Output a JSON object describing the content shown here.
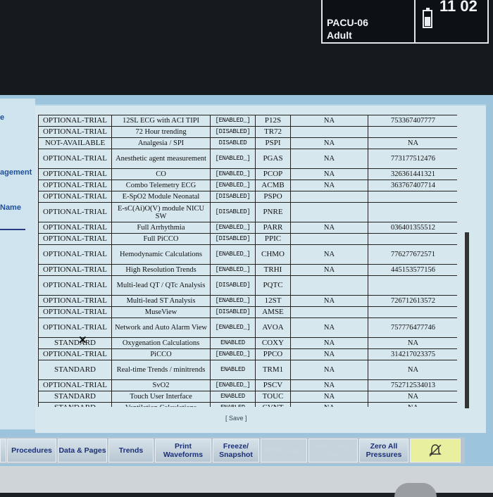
{
  "status": {
    "patient_id": "PACU-06",
    "patient_type": "Adult",
    "clock": "11 02"
  },
  "left_labels": {
    "item1": "e",
    "item2": "agement",
    "item3": "Name"
  },
  "rows": [
    {
      "status": "OPTIONAL-TRIAL",
      "name": "12SL ECG with ACI TIPI",
      "state": "[ENABLED_]",
      "code": "P12S",
      "na": "NA",
      "serial": "753367407777"
    },
    {
      "status": "OPTIONAL-TRIAL",
      "name": "72 Hour trending",
      "state": "[DISABLED]",
      "code": "TR72",
      "na": "",
      "serial": ""
    },
    {
      "status": "NOT-AVAILABLE",
      "name": "Analgesia / SPI",
      "state": "DISABLED",
      "code": "PSPI",
      "na": "NA",
      "serial": "NA"
    },
    {
      "status": "OPTIONAL-TRIAL",
      "name": "Anesthetic agent measurement",
      "state": "[ENABLED_]",
      "code": "PGAS",
      "na": "NA",
      "serial": "773177512476"
    },
    {
      "status": "OPTIONAL-TRIAL",
      "name": "CO",
      "state": "[ENABLED_]",
      "code": "PCOP",
      "na": "NA",
      "serial": "326361441321"
    },
    {
      "status": "OPTIONAL-TRIAL",
      "name": "Combo Telemetry ECG",
      "state": "[ENABLED_]",
      "code": "ACMB",
      "na": "NA",
      "serial": "363767407714"
    },
    {
      "status": "OPTIONAL-TRIAL",
      "name": "E-SpO2 Module Neonatal",
      "state": "[DISABLED]",
      "code": "PSPO",
      "na": "",
      "serial": ""
    },
    {
      "status": "OPTIONAL-TRIAL",
      "name": "E-sC(Ai)O(V) module NICU SW",
      "state": "[DISABLED]",
      "code": "PNRE",
      "na": "",
      "serial": ""
    },
    {
      "status": "OPTIONAL-TRIAL",
      "name": "Full Arrhythmia",
      "state": "[ENABLED_]",
      "code": "PARR",
      "na": "NA",
      "serial": "036401355512"
    },
    {
      "status": "OPTIONAL-TRIAL",
      "name": "Full PiCCO",
      "state": "[DISABLED]",
      "code": "PPIC",
      "na": "",
      "serial": ""
    },
    {
      "status": "OPTIONAL-TRIAL",
      "name": "Hemodynamic Calculations",
      "state": "[ENABLED_]",
      "code": "CHMO",
      "na": "NA",
      "serial": "776277672571"
    },
    {
      "status": "OPTIONAL-TRIAL",
      "name": "High Resolution Trends",
      "state": "[ENABLED_]",
      "code": "TRHI",
      "na": "NA",
      "serial": "445153577156"
    },
    {
      "status": "OPTIONAL-TRIAL",
      "name": "Multi-lead QT / QTc Analysis",
      "state": "[DISABLED]",
      "code": "PQTC",
      "na": "",
      "serial": ""
    },
    {
      "status": "OPTIONAL-TRIAL",
      "name": "Multi-lead ST Analysis",
      "state": "[ENABLED_]",
      "code": "12ST",
      "na": "NA",
      "serial": "726712613572"
    },
    {
      "status": "OPTIONAL-TRIAL",
      "name": "MuseView",
      "state": "[DISABLED]",
      "code": "AMSE",
      "na": "",
      "serial": ""
    },
    {
      "status": "OPTIONAL-TRIAL",
      "name": "Network and Auto Alarm View",
      "state": "[ENABLED_]",
      "code": "AVOA",
      "na": "NA",
      "serial": "757776477746"
    },
    {
      "status": "STANDARD",
      "name": "Oxygenation Calculations",
      "state": "ENABLED",
      "code": "COXY",
      "na": "NA",
      "serial": "NA"
    },
    {
      "status": "OPTIONAL-TRIAL",
      "name": "PiCCO",
      "state": "[ENABLED_]",
      "code": "PPCO",
      "na": "NA",
      "serial": "314217023375"
    },
    {
      "status": "STANDARD",
      "name": "Real-time Trends / minitrends",
      "state": "ENABLED",
      "code": "TRM1",
      "na": "NA",
      "serial": "NA"
    },
    {
      "status": "OPTIONAL-TRIAL",
      "name": "SvO2",
      "state": "[ENABLED_]",
      "code": "PSCV",
      "na": "NA",
      "serial": "752712534013"
    },
    {
      "status": "STANDARD",
      "name": "Touch User Interface",
      "state": "ENABLED",
      "code": "TOUC",
      "na": "NA",
      "serial": "NA"
    },
    {
      "status": "STANDARD",
      "name": "Ventilation Calculations",
      "state": "ENABLED",
      "code": "CVNT",
      "na": "NA",
      "serial": "NA"
    }
  ],
  "save_label": "[ Save ]",
  "toolbar": [
    {
      "label": "Procedures"
    },
    {
      "label": "Data & Pages"
    },
    {
      "label": "Trends"
    },
    {
      "label": "Print Waveforms"
    },
    {
      "label": "Freeze/ Snapshot"
    },
    {
      "label": "NIBP Start"
    },
    {
      "label": "NIBP Auto Start"
    },
    {
      "label": "Zero All Pressures"
    }
  ]
}
